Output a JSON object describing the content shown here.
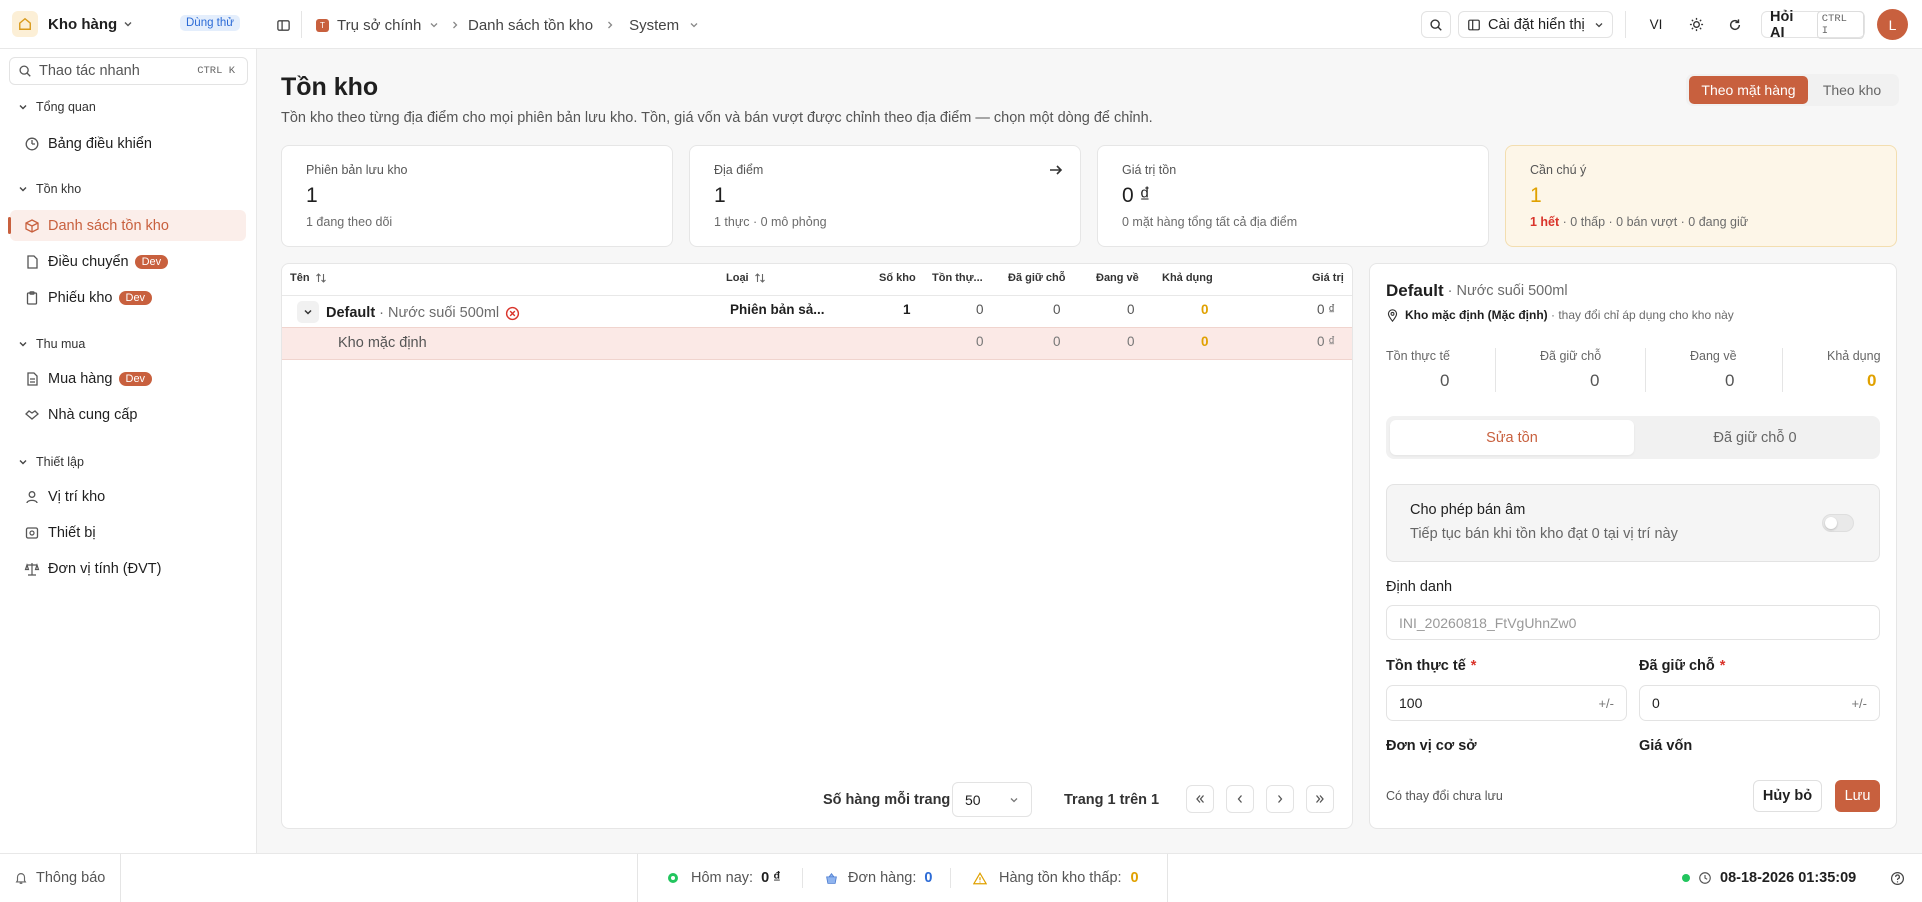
{
  "topbar": {
    "app_name": "Kho hàng",
    "trial_badge": "Dùng thử",
    "location": "Trụ sở chính",
    "breadcrumb": [
      "Danh sách tồn kho",
      "System"
    ],
    "display_settings": "Cài đặt hiển thị",
    "language": "VI",
    "ask_ai": "Hỏi AI",
    "ask_ai_shortcut": "CTRL I",
    "avatar_initial": "L"
  },
  "sidebar": {
    "search_placeholder": "Thao tác nhanh",
    "search_shortcut": "CTRL K",
    "groups": [
      {
        "label": "Tổng quan",
        "items": [
          {
            "label": "Bảng điều khiển"
          }
        ]
      },
      {
        "label": "Tồn kho",
        "items": [
          {
            "label": "Danh sách tồn kho"
          },
          {
            "label": "Điều chuyển",
            "badge": "Dev"
          },
          {
            "label": "Phiếu kho",
            "badge": "Dev"
          }
        ]
      },
      {
        "label": "Thu mua",
        "items": [
          {
            "label": "Mua hàng",
            "badge": "Dev"
          },
          {
            "label": "Nhà cung cấp"
          }
        ]
      },
      {
        "label": "Thiết lập",
        "items": [
          {
            "label": "Vị trí kho"
          },
          {
            "label": "Thiết bị"
          },
          {
            "label": "Đơn vị tính (ĐVT)"
          }
        ]
      }
    ]
  },
  "page": {
    "title": "Tồn kho",
    "subtitle": "Tồn kho theo từng địa điểm cho mọi phiên bản lưu kho. Tồn, giá vốn và bán vượt được chỉnh theo địa điểm — chọn một dòng để chỉnh.",
    "view_toggle": [
      "Theo mặt hàng",
      "Theo kho"
    ]
  },
  "stats": [
    {
      "label": "Phiên bản lưu kho",
      "value": "1",
      "sub": "1 đang theo dõi"
    },
    {
      "label": "Địa điểm",
      "value": "1",
      "sub": "1 thực · 0 mô phỏng"
    },
    {
      "label": "Giá trị tồn",
      "value": "0 ₫",
      "sub": "0 mặt hàng tổng tất cả địa điểm"
    },
    {
      "label": "Cần chú ý",
      "value": "1",
      "sub_highlight": "1 hết",
      "sub": " · 0 thấp · 0 bán vượt · 0 đang giữ"
    }
  ],
  "table": {
    "headers": [
      "Tên",
      "Loại",
      "Số kho",
      "Tồn thự...",
      "Đã giữ chỗ",
      "Đang về",
      "Khả dụng",
      "Giá trị"
    ],
    "rows": [
      {
        "name": "Default",
        "variant": " · Nước suối 500ml",
        "type": "Phiên bản sả...",
        "locations": "1",
        "on_hand": "0",
        "reserved": "0",
        "incoming": "0",
        "available": "0",
        "value": "0 ₫"
      },
      {
        "name": "Kho mặc định",
        "on_hand": "0",
        "reserved": "0",
        "incoming": "0",
        "available": "0",
        "value": "0 ₫"
      }
    ],
    "pagination": {
      "rows_per_page_label": "Số hàng mỗi trang",
      "rows_per_page": "50",
      "page_info": "Trang 1 trên 1"
    }
  },
  "detail": {
    "title": "Default",
    "variant": " · Nước suối 500ml",
    "location": "Kho mặc định (Mặc định)",
    "location_note": " · thay đổi chỉ áp dụng cho kho này",
    "metrics": [
      {
        "label": "Tồn thực tế",
        "value": "0"
      },
      {
        "label": "Đã giữ chỗ",
        "value": "0"
      },
      {
        "label": "Đang về",
        "value": "0"
      },
      {
        "label": "Khả dụng",
        "value": "0"
      }
    ],
    "tabs": [
      "Sửa tồn",
      "Đã giữ chỗ 0"
    ],
    "oversell_title": "Cho phép bán âm",
    "oversell_desc": "Tiếp tục bán khi tồn kho đạt 0 tại vị trí này",
    "identifier_label": "Định danh",
    "identifier_value": "INI_20260818_FtVgUhnZw0",
    "on_hand_label": "Tồn thực tế",
    "on_hand_value": "100",
    "reserved_label": "Đã giữ chỗ",
    "reserved_value": "0",
    "stepper": "+/-",
    "required_mark": "*",
    "base_unit_label": "Đơn vị cơ sở",
    "cost_label": "Giá vốn",
    "unsaved": "Có thay đổi chưa lưu",
    "cancel": "Hủy bỏ",
    "save": "Lưu"
  },
  "statusbar": {
    "notifications": "Thông báo",
    "today_label": "Hôm nay:",
    "today_value": "0 ₫",
    "orders_label": "Đơn hàng:",
    "orders_value": "0",
    "low_stock_label": "Hàng tồn kho thấp:",
    "low_stock_value": "0",
    "datetime": "08-18-2026 01:35:09"
  },
  "colors": {
    "accent": "#c8603e",
    "warning": "#e0a100",
    "alert_bg": "#fdf6e8",
    "danger": "#d9342b",
    "online": "#22c55e"
  }
}
